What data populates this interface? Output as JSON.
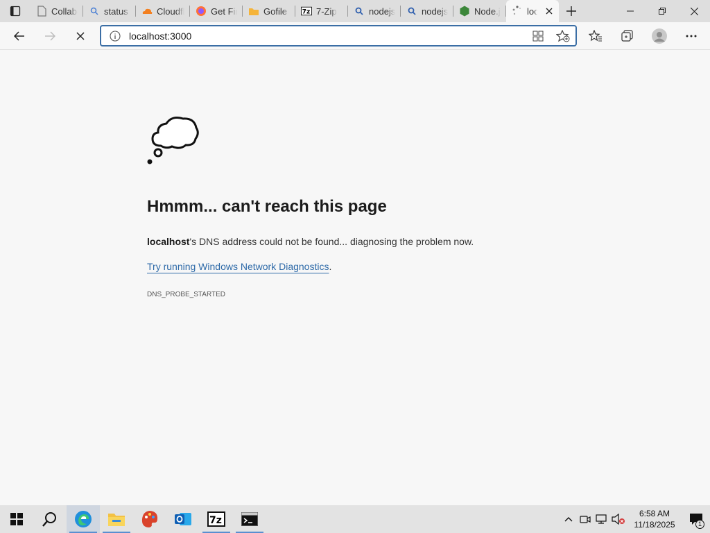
{
  "tabs": [
    {
      "label": "Collabo",
      "icon": "page-icon"
    },
    {
      "label": "status c",
      "icon": "search-icon"
    },
    {
      "label": "Cloudfl",
      "icon": "cloudflare-icon"
    },
    {
      "label": "Get Fire",
      "icon": "firefox-icon"
    },
    {
      "label": "Gofile -",
      "icon": "gofile-icon"
    },
    {
      "label": "7-Zip",
      "icon": "7zip-icon"
    },
    {
      "label": "nodejs",
      "icon": "search-icon"
    },
    {
      "label": "nodejs",
      "icon": "search-icon"
    },
    {
      "label": "Node.js",
      "icon": "nodejs-icon"
    },
    {
      "label": "loc",
      "icon": "loading-icon",
      "active": true
    }
  ],
  "address": {
    "value": "localhost:3000"
  },
  "error": {
    "title": "Hmmm... can't reach this page",
    "host": "localhost",
    "message_rest": "'s DNS address could not be found... diagnosing the problem now.",
    "diagnostics_link": "Try running Windows Network Diagnostics",
    "diagnostics_suffix": ".",
    "code": "DNS_PROBE_STARTED"
  },
  "clock": {
    "time": "6:58 AM",
    "date": "11/18/2025"
  },
  "notification_count": "1",
  "colors": {
    "accent": "#2e6aa8",
    "focus_border": "#3b6ea5"
  }
}
